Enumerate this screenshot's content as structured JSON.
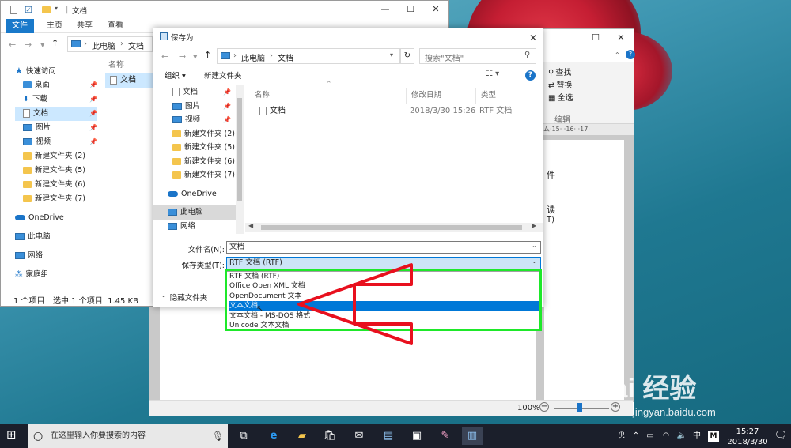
{
  "explorer": {
    "title": "文档",
    "tabs": [
      "文件",
      "主页",
      "共享",
      "查看"
    ],
    "address": [
      "此电脑",
      "文档"
    ],
    "column_name": "名称",
    "sidebar": [
      "快速访问",
      "桌面",
      "下载",
      "文档",
      "图片",
      "视频",
      "新建文件夹 (2)",
      "新建文件夹 (5)",
      "新建文件夹 (6)",
      "新建文件夹 (7)",
      "OneDrive",
      "此电脑",
      "网络",
      "家庭组"
    ],
    "files": [
      "文档"
    ],
    "status_count": "1 个项目",
    "status_selected": "选中 1 个项目  1.45 KB"
  },
  "word": {
    "ribbon": [
      "查找",
      "替换",
      "全选",
      "编辑"
    ],
    "ruler": "ム·15· ·16· ·17·",
    "doc_fragments": [
      "件",
      "读",
      "T)"
    ],
    "zoom": "100%",
    "zoom_minus": "−",
    "zoom_plus": "+"
  },
  "dialog": {
    "title": "保存为",
    "address": [
      "此电脑",
      "文档"
    ],
    "search_placeholder": "搜索\"文档\"",
    "organize": "组织 ▾",
    "new_folder": "新建文件夹",
    "help": "?",
    "columns": [
      "名称",
      "修改日期",
      "类型"
    ],
    "sidebar": [
      "文档",
      "图片",
      "视频",
      "新建文件夹 (2)",
      "新建文件夹 (5)",
      "新建文件夹 (6)",
      "新建文件夹 (7)",
      "OneDrive",
      "此电脑",
      "网络"
    ],
    "files": [
      {
        "name": "文档",
        "date": "2018/3/30 15:26",
        "type": "RTF 文档"
      }
    ],
    "filename_label": "文件名(N):",
    "filename_value": "文档",
    "filetype_label": "保存类型(T):",
    "filetype_value": "RTF 文档 (RTF)",
    "hide_folders": "隐藏文件夹",
    "type_options": [
      "RTF 文档 (RTF)",
      "Office Open XML 文档",
      "OpenDocument 文本",
      "文本文档",
      "文本文档 - MS-DOS 格式",
      "Unicode 文本文档"
    ],
    "highlighted_option": 3
  },
  "taskbar": {
    "search_text": "在这里输入你要搜索的内容",
    "ime": "中",
    "ime2": "M",
    "time": "15:27",
    "date": "2018/3/30"
  },
  "watermark": {
    "site": "jingyan.baidu.com",
    "brand": "Bai 经验"
  },
  "colors": {
    "accent": "#1979ca",
    "selection": "#0078d7",
    "annotation_green": "#1ee82a",
    "annotation_red": "#e8101e"
  }
}
